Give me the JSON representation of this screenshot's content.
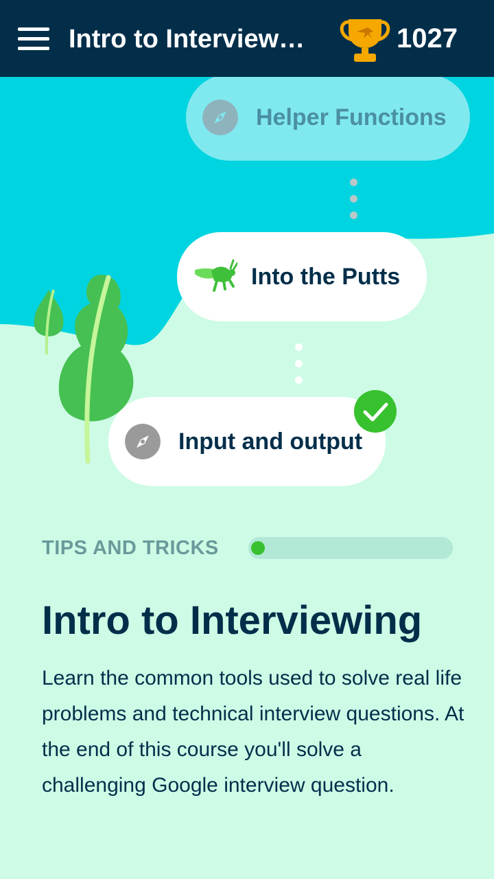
{
  "appbar": {
    "title": "Intro to Interviewing",
    "score": "1027",
    "menu_icon": "hamburger-menu-icon",
    "trophy_icon": "trophy-icon"
  },
  "path": {
    "nodes": [
      {
        "label": "Helper Functions",
        "icon": "compass-icon",
        "state": "upcoming"
      },
      {
        "label": "Into the Putts",
        "icon": "grasshopper-icon",
        "state": "current"
      },
      {
        "label": "Input and output",
        "icon": "compass-icon",
        "state": "completed"
      }
    ]
  },
  "course": {
    "section_label": "TIPS AND TRICKS",
    "progress": 0.03,
    "title": "Intro to Interviewing",
    "description": "Learn the common tools used to solve real life problems and technical interview questions. At the end of this course you'll solve a challenging Google interview question."
  },
  "colors": {
    "appbar": "#022e4a",
    "sky": "#00d4e0",
    "ground": "#cdfbe6",
    "accent_green": "#38c12e",
    "text_dark": "#022e4a"
  }
}
